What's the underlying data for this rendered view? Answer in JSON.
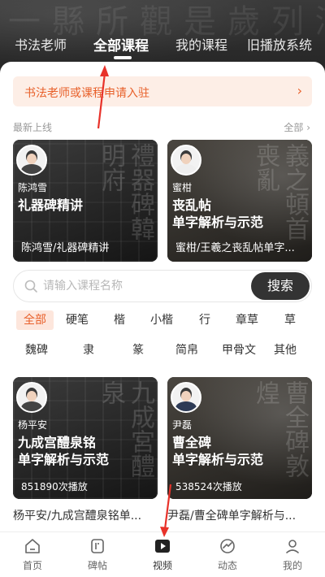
{
  "header": {
    "tabs": [
      "书法老师",
      "全部课程",
      "我的课程",
      "旧播放系统"
    ],
    "active_tab": "全部课程"
  },
  "banner": {
    "text": "书法老师或课程申请入驻",
    "arrow": "›"
  },
  "latest": {
    "label": "最新上线",
    "all_label": "全部",
    "all_arrow": "›"
  },
  "cards_top": [
    {
      "name": "陈鸿雪",
      "title": "礼器碑精讲",
      "subtitle": "陈鸿雪/礼器碑精讲"
    },
    {
      "name": "蜜柑",
      "title": "丧乱帖\n单字解析与示范",
      "subtitle": "蜜柑/王羲之丧乱帖单字..."
    }
  ],
  "search": {
    "placeholder": "请输入课程名称",
    "button": "搜索",
    "icon": "search-icon"
  },
  "filters_row1": [
    "全部",
    "硬笔",
    "楷",
    "小楷",
    "行",
    "章草",
    "草"
  ],
  "filters_row2": [
    "魏碑",
    "隶",
    "篆",
    "简帛",
    "甲骨文",
    "其他"
  ],
  "active_filter": "全部",
  "cards_bottom": [
    {
      "name": "杨平安",
      "title": "九成宫醴泉铭\n单字解析与示范",
      "plays": "851890次播放",
      "caption": "杨平安/九成宫醴泉铭单..."
    },
    {
      "name": "尹磊",
      "title": "曹全碑\n单字解析与示范",
      "plays": "538524次播放",
      "caption": "尹磊/曹全碑单字解析与..."
    }
  ],
  "nav": [
    {
      "label": "首页",
      "icon": "home-icon"
    },
    {
      "label": "碑帖",
      "icon": "book-icon"
    },
    {
      "label": "视频",
      "icon": "video-play-icon"
    },
    {
      "label": "动态",
      "icon": "trend-icon"
    },
    {
      "label": "我的",
      "icon": "user-icon"
    }
  ],
  "colors": {
    "accent": "#e8602a",
    "accent_bg": "#fdeee6",
    "annotation_arrow": "#e8322a"
  }
}
